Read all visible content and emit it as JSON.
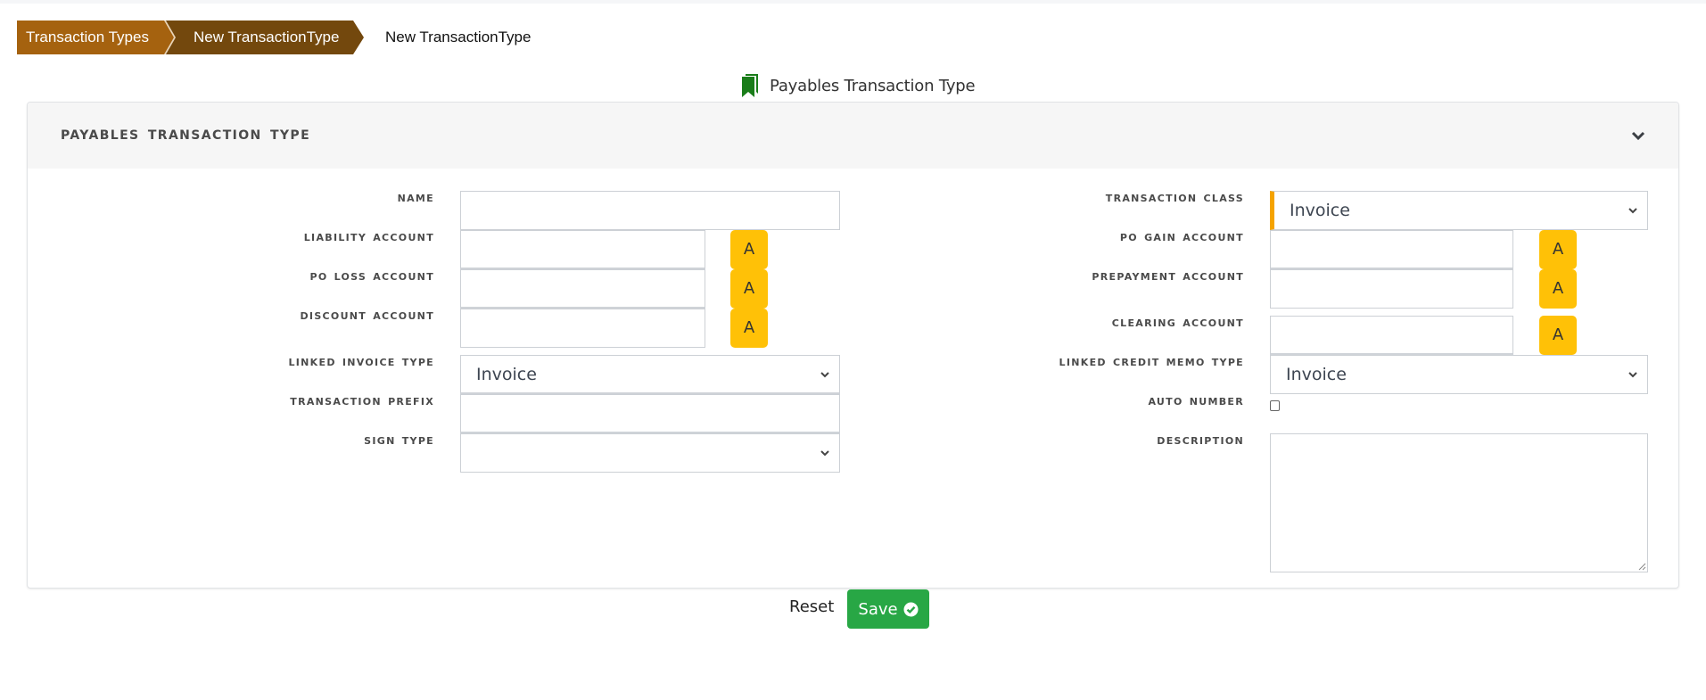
{
  "breadcrumb": {
    "items": [
      "Transaction Types",
      "New TransactionType"
    ],
    "current": "New TransactionType"
  },
  "page": {
    "title": "Payables Transaction Type",
    "title_icon": "bookmark-icon",
    "icon_color": "#1a7d1a"
  },
  "panel": {
    "header": "PAYABLES TRANSACTION TYPE",
    "collapse_icon": "chevron-down-icon"
  },
  "form": {
    "left": {
      "name": {
        "label": "NAME",
        "value": ""
      },
      "liability_account": {
        "label": "LIABILITY ACCOUNT",
        "value": "",
        "button": "A"
      },
      "po_loss_account": {
        "label": "PO LOSS ACCOUNT",
        "value": "",
        "button": "A"
      },
      "discount_account": {
        "label": "DISCOUNT ACCOUNT",
        "value": "",
        "button": "A"
      },
      "linked_invoice_type": {
        "label": "LINKED INVOICE TYPE",
        "value": "Invoice"
      },
      "transaction_prefix": {
        "label": "TRANSACTION PREFIX",
        "value": ""
      },
      "sign_type": {
        "label": "SIGN TYPE",
        "value": ""
      }
    },
    "right": {
      "transaction_class": {
        "label": "TRANSACTION CLASS",
        "value": "Invoice",
        "required": true
      },
      "po_gain_account": {
        "label": "PO GAIN ACCOUNT",
        "value": "",
        "button": "A"
      },
      "prepayment_account": {
        "label": "PREPAYMENT ACCOUNT",
        "value": "",
        "button": "A"
      },
      "clearing_account": {
        "label": "CLEARING ACCOUNT",
        "value": "",
        "button": "A"
      },
      "linked_credit_memo_type": {
        "label": "LINKED CREDIT MEMO TYPE",
        "value": "Invoice"
      },
      "auto_number": {
        "label": "AUTO NUMBER",
        "checked": false
      },
      "description": {
        "label": "DESCRIPTION",
        "value": ""
      }
    }
  },
  "actions": {
    "reset": "Reset",
    "save": "Save"
  },
  "colors": {
    "crumb_primary": "#a5620f",
    "crumb_active": "#73480d",
    "lookup_button": "#ffc107",
    "required_marker": "#f5a300",
    "save_button": "#28a745"
  }
}
